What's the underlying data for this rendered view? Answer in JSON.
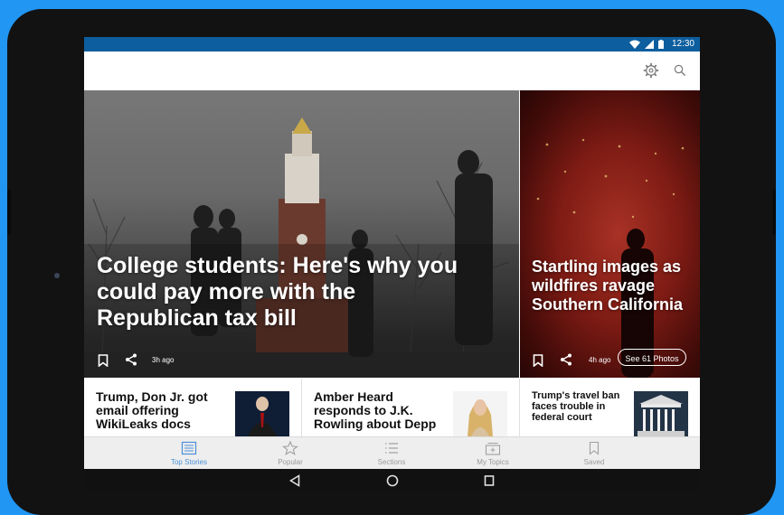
{
  "status_bar": {
    "time": "12:30"
  },
  "icons": {
    "wifi": "wifi-icon",
    "signal": "signal-icon",
    "battery": "battery-icon",
    "settings": "gear-icon",
    "search": "search-icon",
    "bookmark": "bookmark-icon",
    "share": "share-icon",
    "back": "back-icon",
    "home": "home-icon",
    "recents": "recents-icon"
  },
  "colors": {
    "status_bar": "#0d5e9e",
    "accent": "#4a8fd6",
    "device_bg": "#2196f3"
  },
  "hero": {
    "title": "College students: Here's why you could pay more with the Republican tax bill",
    "age": "3h ago"
  },
  "side_story": {
    "title": "Startling images as wildfires ravage Southern California",
    "age": "4h ago",
    "photos_button": "See 61 Photos"
  },
  "cards": [
    {
      "title": "Trump, Don Jr. got email offering WikiLeaks docs"
    },
    {
      "title": "Amber Heard responds to J.K. Rowling about Depp"
    },
    {
      "title": "Trump's travel ban faces trouble in federal court"
    }
  ],
  "bottom_nav": [
    {
      "label": "Top Stories",
      "icon": "news-icon",
      "active": true
    },
    {
      "label": "Popular",
      "icon": "star-icon",
      "active": false
    },
    {
      "label": "Sections",
      "icon": "list-icon",
      "active": false
    },
    {
      "label": "My Topics",
      "icon": "topics-icon",
      "active": false
    },
    {
      "label": "Saved",
      "icon": "bookmark-icon",
      "active": false
    }
  ]
}
